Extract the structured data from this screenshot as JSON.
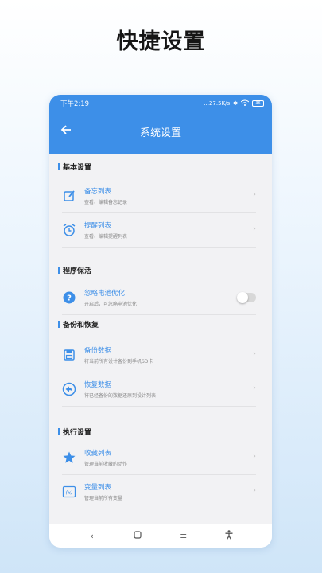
{
  "promo": {
    "title": "快捷设置"
  },
  "status_bar": {
    "time": "下午2:19",
    "network_speed": "...27.5K/s",
    "battery": "36"
  },
  "app_bar": {
    "title": "系统设置",
    "back_icon": "arrow-left-icon"
  },
  "sections": [
    {
      "title": "基本设置",
      "items": [
        {
          "label": "备忘列表",
          "sub": "查看、编辑备忘记录",
          "icon": "edit-note-icon",
          "control": "chevron"
        },
        {
          "label": "提醒列表",
          "sub": "查看、编辑提醒列表",
          "icon": "alarm-clock-icon",
          "control": "chevron"
        }
      ]
    },
    {
      "title": "程序保活",
      "items": [
        {
          "label": "忽略电池优化",
          "sub": "开启后，可忽略电池优化",
          "icon": "help-circle-icon",
          "control": "toggle",
          "toggle_on": false
        }
      ]
    },
    {
      "title": "备份和恢复",
      "items": [
        {
          "label": "备份数据",
          "sub": "将当前所有设计备份到手机SD卡",
          "icon": "save-icon",
          "control": "chevron"
        },
        {
          "label": "恢复数据",
          "sub": "将已经备份的数据还原到设计列表",
          "icon": "restore-icon",
          "control": "chevron"
        }
      ]
    },
    {
      "title": "执行设置",
      "items": [
        {
          "label": "收藏列表",
          "sub": "管理当前收藏的动作",
          "icon": "star-icon",
          "control": "chevron"
        },
        {
          "label": "变量列表",
          "sub": "管理当前所有变量",
          "icon": "variable-icon",
          "control": "chevron"
        }
      ]
    }
  ],
  "nav_bar": {
    "back": "‹",
    "home": "○",
    "menu": "≡",
    "accessibility": "accessibility-icon"
  },
  "colors": {
    "accent": "#3d8fe8",
    "background": "#f2f2f4"
  }
}
